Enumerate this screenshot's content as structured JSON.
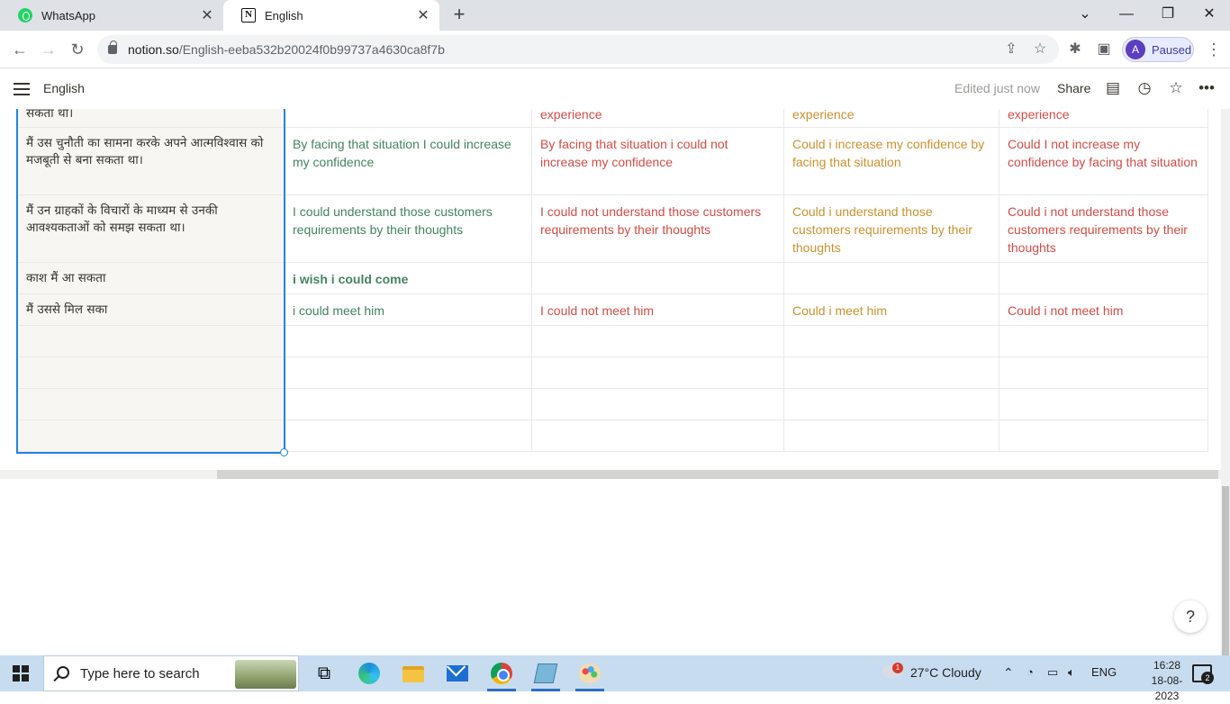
{
  "browser": {
    "tabs": [
      {
        "label": "WhatsApp",
        "icon": "whatsapp-icon"
      },
      {
        "label": "English",
        "icon": "notion-icon"
      }
    ],
    "url_host": "notion.so",
    "url_path": "/English-eeba532b20024f0b99737a4630ca8f7b",
    "profile_initial": "A",
    "profile_status": "Paused"
  },
  "notion": {
    "page_title": "English",
    "edited_status": "Edited just now",
    "share_label": "Share"
  },
  "table": {
    "rows": [
      {
        "hindi": "सकता था।",
        "affirmative": "",
        "negative": "experience",
        "question": "experience",
        "neg_question": "experience"
      },
      {
        "hindi": "मैं उस चुनौती का सामना करके अपने आत्मविश्वास को मजबूती से बना सकता था।",
        "affirmative": "By facing that situation I could increase my confidence",
        "negative": "By facing that situation i could not increase my confidence",
        "question": "Could i increase my confidence by facing that situation",
        "neg_question": "Could I not increase my confidence by facing that situation"
      },
      {
        "hindi": "मैं उन ग्राहकों के विचारों के माध्यम से उनकी आवश्यकताओं को समझ सकता था।",
        "affirmative": "I could understand those customers requirements by their thoughts",
        "negative": "I could not understand those customers requirements by their thoughts",
        "question": "Could i understand those customers requirements by their thoughts",
        "neg_question": "Could i not understand those customers requirements by their thoughts"
      },
      {
        "hindi": "काश मैं आ सकता",
        "affirmative": "i wish i could come",
        "negative": "",
        "question": "",
        "neg_question": ""
      },
      {
        "hindi": "मैं उससे मिल सका",
        "affirmative": "i could meet him",
        "negative": "I could not meet him",
        "question": "Could i meet him",
        "neg_question": "Could i not meet him"
      },
      {
        "hindi": "",
        "affirmative": "",
        "negative": "",
        "question": "",
        "neg_question": ""
      },
      {
        "hindi": "",
        "affirmative": "",
        "negative": "",
        "question": "",
        "neg_question": ""
      },
      {
        "hindi": "",
        "affirmative": "",
        "negative": "",
        "question": "",
        "neg_question": ""
      },
      {
        "hindi": "",
        "affirmative": "",
        "negative": "",
        "question": "",
        "neg_question": ""
      }
    ]
  },
  "help_label": "?",
  "taskbar": {
    "search_placeholder": "Type here to search",
    "weather_badge": "1",
    "weather": "27°C  Cloudy",
    "language": "ENG",
    "time": "16:28",
    "date": "18-08-2023",
    "notification_count": "2"
  }
}
